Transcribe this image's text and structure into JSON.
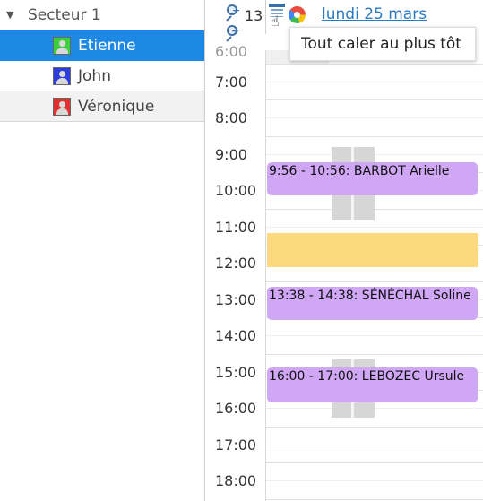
{
  "tree": {
    "group": {
      "label": "Secteur 1"
    },
    "resources": [
      {
        "label": "Etienne",
        "avatar_color": "#3fcf3f"
      },
      {
        "label": "John",
        "avatar_color": "#2c3ddb"
      },
      {
        "label": "Véronique",
        "avatar_color": "#e03030"
      }
    ]
  },
  "toolbar": {
    "zoom_level": "13",
    "zoom_in_icon": "zoom-in-icon",
    "zoom_out_icon": "zoom-out-icon",
    "day_link": "lundi 25 mars",
    "tooltip": "Tout caler au plus tôt"
  },
  "calendar": {
    "partial_top_hour": "6:00",
    "hours": [
      "7:00",
      "8:00",
      "9:00",
      "10:00",
      "11:00",
      "12:00",
      "13:00",
      "14:00",
      "15:00",
      "16:00",
      "17:00",
      "18:00"
    ],
    "events": [
      {
        "label": "9:56 - 10:56: BARBOT Arielle"
      },
      {
        "label": "13:38 - 14:38: SÉNÉCHAL Soline"
      },
      {
        "label": "16:00 - 17:00: LEBOZEC Ursule"
      }
    ],
    "colors": {
      "event": "#cfa7f4",
      "blocked": "#fcd97c",
      "availability": "#d6d6d6",
      "selected": "#1e88e5"
    }
  }
}
